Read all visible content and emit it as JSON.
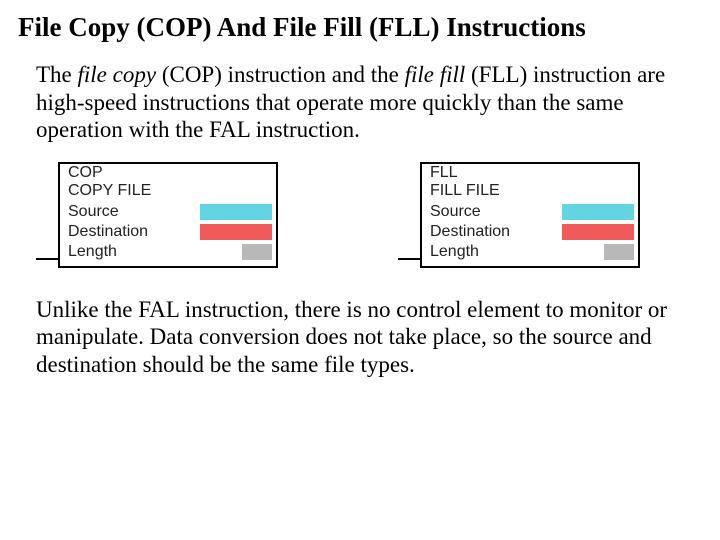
{
  "title": "File Copy (COP) And File Fill (FLL) Instructions",
  "para1": {
    "pre": "The ",
    "em1": "file copy",
    "mid1": " (COP) instruction and the ",
    "em2": "file fill",
    "mid2": " (FLL) instruction are high-speed instructions that operate more quickly than the same operation with the FAL instruction."
  },
  "blocks": [
    {
      "mnemonic": "COP",
      "subtitle": "COPY FILE",
      "rows": [
        {
          "label": "Source",
          "swatch": "cyan",
          "size": "full"
        },
        {
          "label": "Destination",
          "swatch": "red",
          "size": "full"
        },
        {
          "label": "Length",
          "swatch": "gray",
          "size": "small"
        }
      ]
    },
    {
      "mnemonic": "FLL",
      "subtitle": "FILL FILE",
      "rows": [
        {
          "label": "Source",
          "swatch": "cyan",
          "size": "full"
        },
        {
          "label": "Destination",
          "swatch": "red",
          "size": "full"
        },
        {
          "label": "Length",
          "swatch": "gray",
          "size": "small"
        }
      ]
    }
  ],
  "para2": "Unlike the FAL instruction, there is no control element to monitor or manipulate. Data conversion does not take place, so the source and destination should be the same file types."
}
